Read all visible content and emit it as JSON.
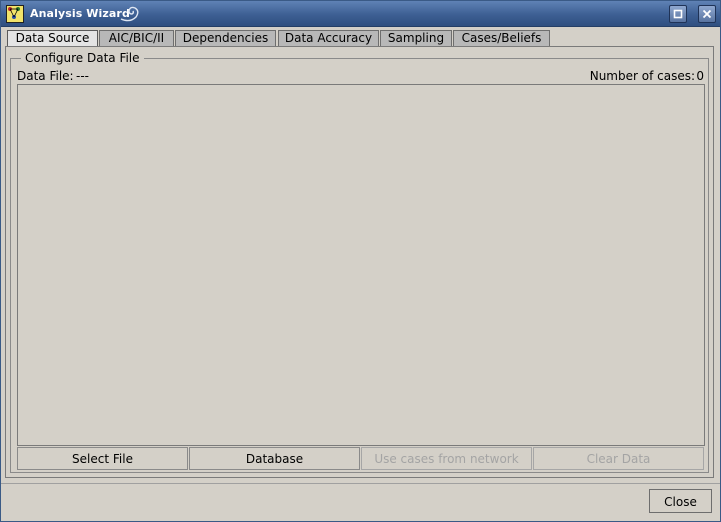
{
  "window": {
    "title": "Analysis Wizard",
    "close_label": "Close"
  },
  "tabs": [
    {
      "label": "Data Source",
      "active": true
    },
    {
      "label": "AIC/BIC/II",
      "active": false
    },
    {
      "label": "Dependencies",
      "active": false
    },
    {
      "label": "Data Accuracy",
      "active": false
    },
    {
      "label": "Sampling",
      "active": false
    },
    {
      "label": "Cases/Beliefs",
      "active": false
    }
  ],
  "data_source": {
    "group_title": "Configure Data File",
    "data_file_label": "Data File:",
    "data_file_value": "---",
    "cases_label": "Number of cases:",
    "cases_value": "0",
    "buttons": {
      "select_file": "Select File",
      "database": "Database",
      "use_cases": "Use cases from network",
      "clear_data": "Clear Data"
    }
  },
  "icons": {
    "app": "app-icon",
    "maximize": "maximize-icon",
    "close": "close-icon",
    "swirl": "swirl-icon"
  }
}
